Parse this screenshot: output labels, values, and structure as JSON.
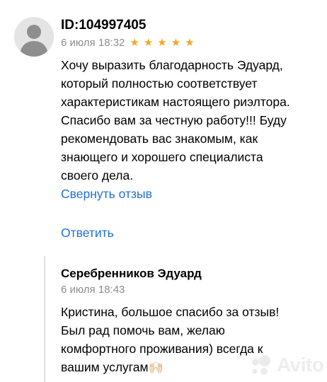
{
  "review": {
    "author_id": "ID:104997405",
    "date": "6 июля 18:32",
    "rating": 5,
    "star_color": "#f5a623",
    "text_lines": [
      "Хочу выразить благодарность Эдуард,",
      "который полностью соответствует",
      "характеристикам настоящего риэлтора.",
      "Спасибо вам за честную работу!!! Буду",
      "рекомендовать вас знакомым, как",
      "знающего и хорошего специалиста",
      "своего дела."
    ],
    "collapse_label": "Свернуть отзыв",
    "reply_label": "Ответить"
  },
  "seller_reply": {
    "author": "Серебренников Эдуард",
    "date": "6 июля 18:43",
    "text_lines": [
      "Кристина, большое спасибо за отзыв!",
      "Был рад помочь вам, желаю",
      "комфортного проживания) всегда к",
      "вашим услугам"
    ],
    "emoji": "🙌🏻"
  },
  "watermark": {
    "logo_text": "Avito"
  },
  "colors": {
    "link": "#1f6fd6",
    "muted_text": "#8c8c8c",
    "star": "#f5a623",
    "reply_bar": "#e2e2e2"
  }
}
